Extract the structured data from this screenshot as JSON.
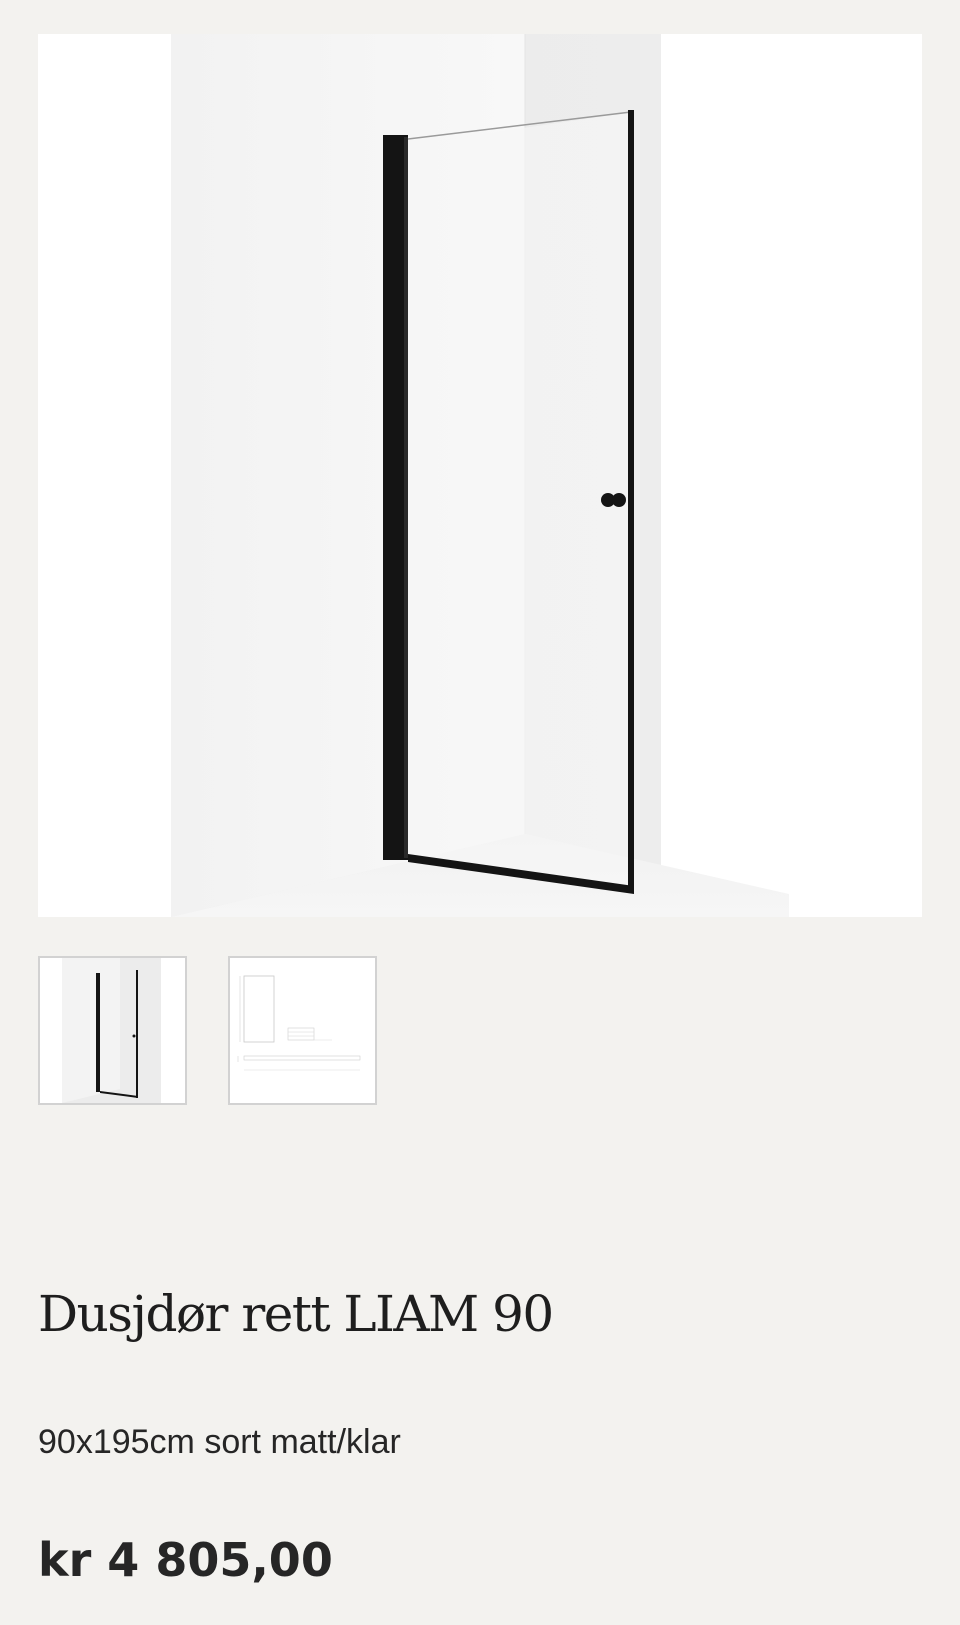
{
  "product": {
    "title": "Dusjdør rett LIAM 90",
    "variant": "90x195cm sort matt/klar",
    "price": "kr 4 805,00"
  },
  "gallery": {
    "main_image": "shower-door-photo",
    "thumbnails": [
      {
        "image": "shower-door-photo"
      },
      {
        "image": "technical-drawing"
      }
    ]
  },
  "colors": {
    "page_background": "#f3f2ef",
    "frame": "#141414",
    "text": "#1e1e1e"
  }
}
